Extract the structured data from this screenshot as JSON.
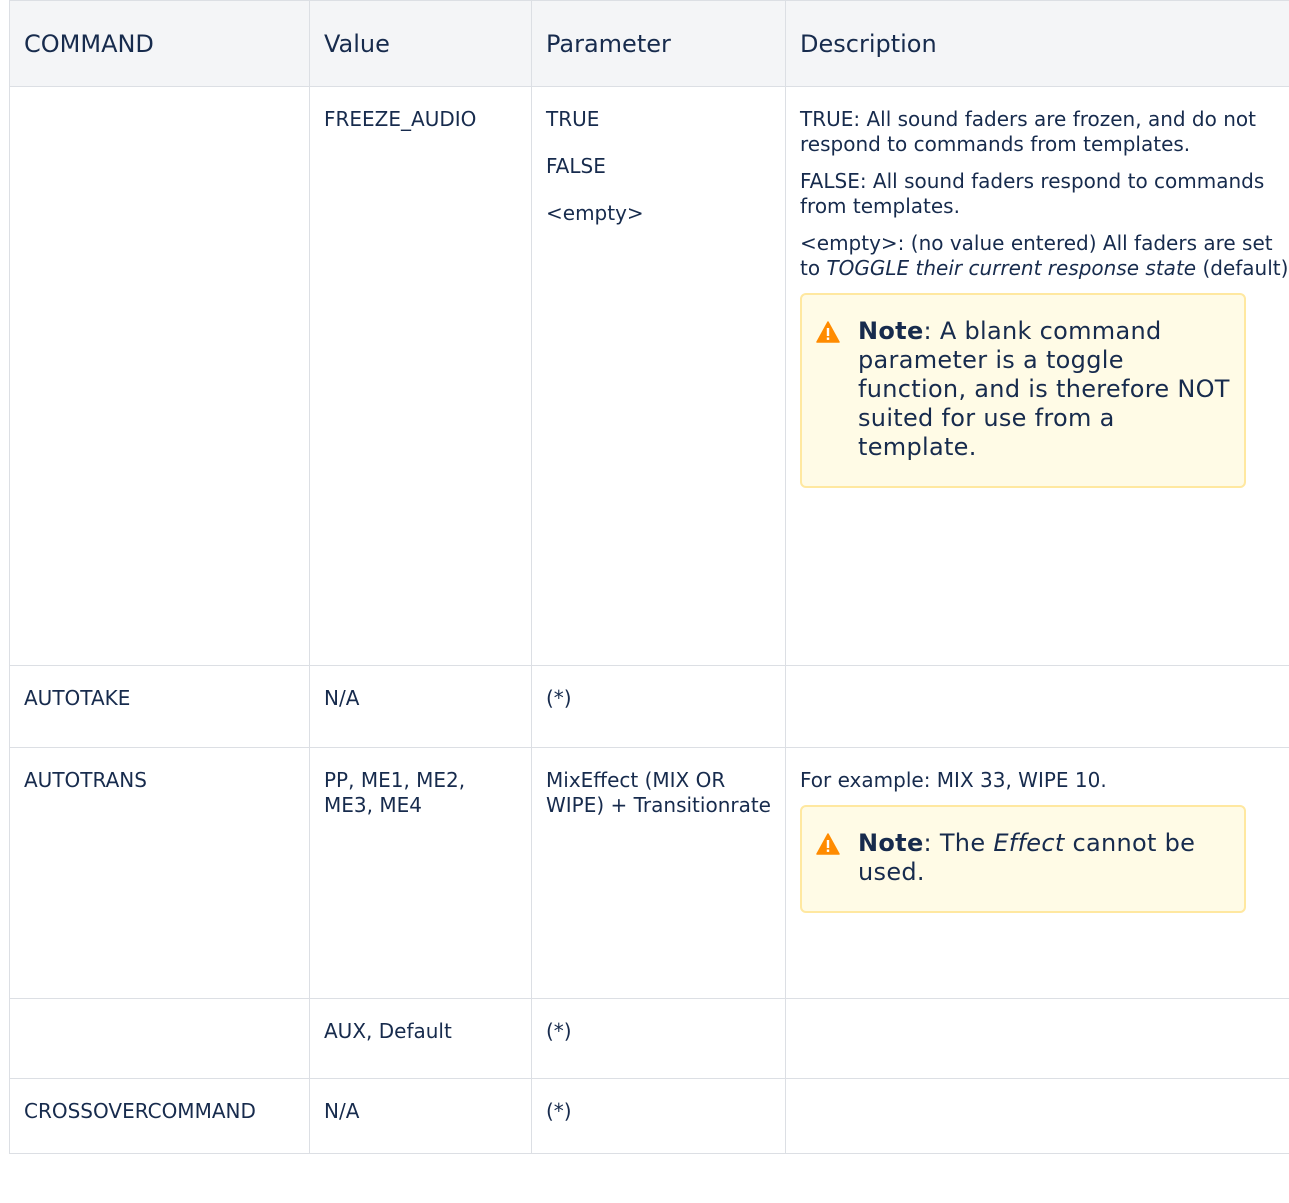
{
  "headers": [
    "COMMAND",
    "Value",
    "Parameter",
    "Description"
  ],
  "rows": [
    {
      "command": "",
      "value": "FREEZE_AUDIO",
      "params": [
        "TRUE",
        "FALSE",
        "<empty>"
      ],
      "desc1": "TRUE: All sound faders are frozen, and do not respond to commands from templates.",
      "desc2": "FALSE: All sound faders  respond to commands from templates.",
      "desc3_a": "<empty>: (no value entered) All faders are set to ",
      "desc3_i": "TOGGLE their current response state",
      "desc3_b": " (default).",
      "note_label": "Note",
      "note_text": ": A blank command parameter is a toggle function, and is therefore NOT suited for use from a template."
    },
    {
      "command": "AUTOTAKE",
      "value": "N/A",
      "param": "(*)"
    },
    {
      "command": "AUTOTRANS",
      "value": "PP, ME1, ME2, ME3, ME4",
      "param": "MixEffect (MIX OR WIPE) + Transitionrate",
      "desc": "For example: MIX 33, WIPE 10.",
      "note_label": "Note",
      "note_a": ": The ",
      "note_i": "Effect",
      "note_b": " cannot be used."
    },
    {
      "command": "",
      "value": "AUX, Default",
      "param": "(*)"
    },
    {
      "command": "CROSSOVERCOMMAND",
      "value": "N/A",
      "param": "(*)"
    }
  ],
  "colors": {
    "header_bg": "#f4f5f7",
    "border": "#dcdfe4",
    "note_bg": "#fffbe6",
    "note_border": "#ffe8a0",
    "warning_icon": "#ff8b00"
  },
  "icons": {
    "note_icon": "warning-icon"
  }
}
